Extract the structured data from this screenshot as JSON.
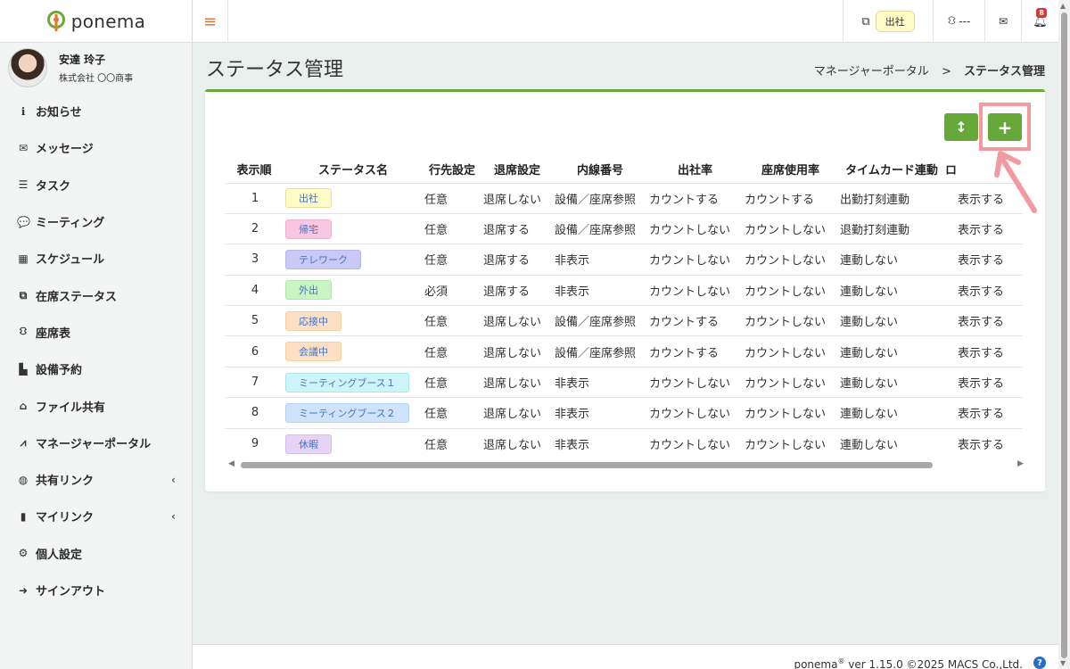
{
  "brand": {
    "name": "ponema"
  },
  "user": {
    "name": "安達 玲子",
    "company": "株式会社 〇〇商事"
  },
  "nav": [
    {
      "label": "お知らせ",
      "icon": "info-icon",
      "glyph": "ℹ"
    },
    {
      "label": "メッセージ",
      "icon": "envelope-icon",
      "glyph": "✉"
    },
    {
      "label": "タスク",
      "icon": "list-icon",
      "glyph": "☰"
    },
    {
      "label": "ミーティング",
      "icon": "chat-icon",
      "glyph": "💬"
    },
    {
      "label": "スケジュール",
      "icon": "calendar-icon",
      "glyph": "▦"
    },
    {
      "label": "在席ステータス",
      "icon": "presence-icon",
      "glyph": "⧉"
    },
    {
      "label": "座席表",
      "icon": "seat-icon",
      "glyph": "⛻"
    },
    {
      "label": "設備予約",
      "icon": "facility-icon",
      "glyph": "▙"
    },
    {
      "label": "ファイル共有",
      "icon": "folder-icon",
      "glyph": "⌂"
    },
    {
      "label": "マネージャーポータル",
      "icon": "chart-line-icon",
      "glyph": "⩘"
    },
    {
      "label": "共有リンク",
      "icon": "globe-icon",
      "glyph": "◍",
      "expandable": true
    },
    {
      "label": "マイリンク",
      "icon": "bookmark-icon",
      "glyph": "▮",
      "expandable": true
    },
    {
      "label": "個人設定",
      "icon": "gear-icon",
      "glyph": "⚙"
    },
    {
      "label": "サインアウト",
      "icon": "signout-icon",
      "glyph": "➜"
    }
  ],
  "header": {
    "presence_label": "出社",
    "seat_label": "---",
    "notification_count": "8"
  },
  "page": {
    "title": "ステータス管理",
    "breadcrumb_parent": "マネージャーポータル",
    "breadcrumb_sep": ">",
    "breadcrumb_current": "ステータス管理"
  },
  "actions": {
    "sort_glyph": "↕",
    "add_glyph": "+"
  },
  "table": {
    "columns": [
      "表示順",
      "ステータス名",
      "行先設定",
      "退席設定",
      "内線番号",
      "出社率",
      "座席使用率",
      "タイムカード連動",
      "ロ"
    ],
    "rows": [
      {
        "order": "1",
        "name": "出社",
        "bg": "#fffbc7",
        "border": "#e8df9a",
        "dest": "任意",
        "leave": "退席しない",
        "ext": "設備／座席参照",
        "attend": "カウントする",
        "seat": "カウントする",
        "timecard": "出勤打刻連動",
        "display": "表示する"
      },
      {
        "order": "2",
        "name": "帰宅",
        "bg": "#f9c6e2",
        "border": "#f3b0d4",
        "dest": "任意",
        "leave": "退席する",
        "ext": "設備／座席参照",
        "attend": "カウントしない",
        "seat": "カウントしない",
        "timecard": "退勤打刻連動",
        "display": "表示する"
      },
      {
        "order": "3",
        "name": "テレワーク",
        "bg": "#c9c9f5",
        "border": "#b7b7ee",
        "dest": "任意",
        "leave": "退席する",
        "ext": "非表示",
        "attend": "カウントしない",
        "seat": "カウントしない",
        "timecard": "連動しない",
        "display": "表示する"
      },
      {
        "order": "4",
        "name": "外出",
        "bg": "#c9f5c4",
        "border": "#b1e8aa",
        "dest": "必須",
        "leave": "退席する",
        "ext": "非表示",
        "attend": "カウントしない",
        "seat": "カウントしない",
        "timecard": "連動しない",
        "display": "表示する"
      },
      {
        "order": "5",
        "name": "応接中",
        "bg": "#fde0c3",
        "border": "#f6cfa7",
        "dest": "任意",
        "leave": "退席しない",
        "ext": "設備／座席参照",
        "attend": "カウントする",
        "seat": "カウントしない",
        "timecard": "連動しない",
        "display": "表示する"
      },
      {
        "order": "6",
        "name": "会議中",
        "bg": "#fde0c3",
        "border": "#f6cfa7",
        "dest": "任意",
        "leave": "退席しない",
        "ext": "設備／座席参照",
        "attend": "カウントする",
        "seat": "カウントしない",
        "timecard": "連動しない",
        "display": "表示する"
      },
      {
        "order": "7",
        "name": "ミーティングブース１",
        "bg": "#cdf5f8",
        "border": "#a9e6ec",
        "dest": "任意",
        "leave": "退席しない",
        "ext": "非表示",
        "attend": "カウントしない",
        "seat": "カウントしない",
        "timecard": "連動しない",
        "display": "表示する"
      },
      {
        "order": "8",
        "name": "ミーティングブース２",
        "bg": "#cfe4fb",
        "border": "#b3d2f3",
        "dest": "任意",
        "leave": "退席しない",
        "ext": "非表示",
        "attend": "カウントしない",
        "seat": "カウントしない",
        "timecard": "連動しない",
        "display": "表示する"
      },
      {
        "order": "9",
        "name": "休暇",
        "bg": "#e6d4f7",
        "border": "#d5bdef",
        "dest": "任意",
        "leave": "退席しない",
        "ext": "非表示",
        "attend": "カウントしない",
        "seat": "カウントしない",
        "timecard": "連動しない",
        "display": "表示する"
      }
    ]
  },
  "footer": {
    "product": "ponema",
    "reg_mark": "®",
    "version": "ver 1.15.0 ©2025 MACS Co.,Ltd."
  },
  "colors": {
    "accent_green": "#66a83a",
    "accent_orange": "#e8762d",
    "highlight_pink": "#f39aa1"
  }
}
